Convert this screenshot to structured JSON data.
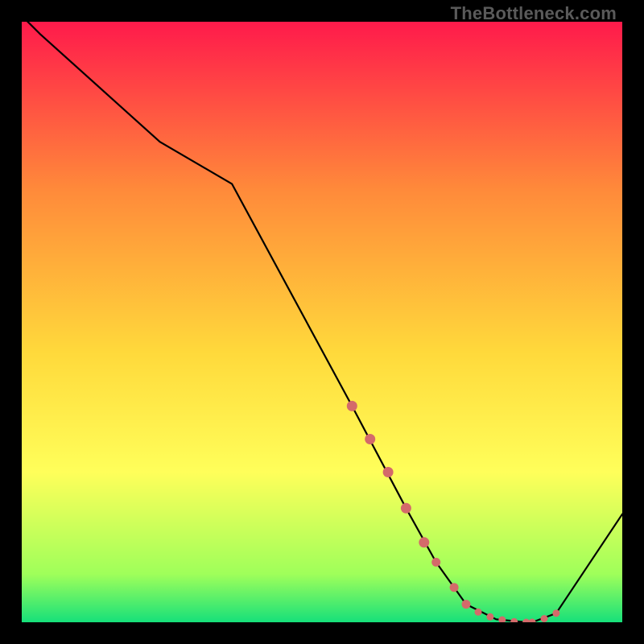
{
  "branding": "TheBottleneck.com",
  "chart_data": {
    "type": "line",
    "title": "",
    "xlabel": "",
    "ylabel": "",
    "xlim": [
      0,
      100
    ],
    "ylim": [
      0,
      100
    ],
    "series": [
      {
        "name": "curve",
        "x": [
          0,
          3,
          23,
          35,
          55,
          64,
          69,
          74,
          79,
          84,
          85,
          89,
          100
        ],
        "values": [
          101,
          98,
          80,
          73,
          36,
          19,
          10,
          3,
          0.5,
          0,
          0,
          1.5,
          18
        ]
      }
    ],
    "highlight": {
      "name": "bottleneck-region",
      "x": [
        55,
        58,
        61,
        64,
        67,
        69,
        72,
        74,
        76,
        78,
        80,
        82,
        84,
        85,
        87,
        89
      ],
      "values": [
        36,
        30.5,
        25,
        19,
        13.3,
        10,
        5.8,
        3,
        1.7,
        0.9,
        0.4,
        0.1,
        0,
        0,
        0.6,
        1.5
      ]
    },
    "gradient": {
      "top": "#ff1a4b",
      "q1": "#ff8a3a",
      "mid": "#ffd93b",
      "q3": "#ffff5a",
      "low": "#9fff5a",
      "bot": "#16e07a"
    }
  }
}
